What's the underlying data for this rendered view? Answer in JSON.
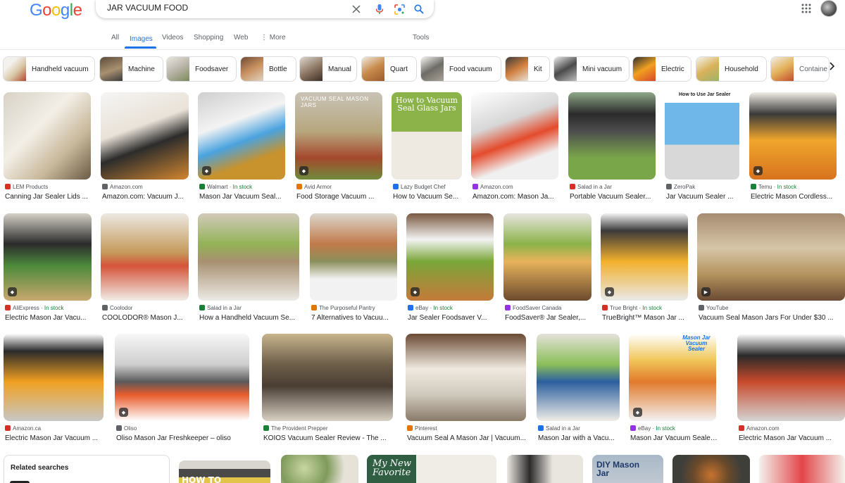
{
  "header": {
    "logo": "Google",
    "logo_colors": [
      "#4285f4",
      "#ea4335",
      "#fbbc05",
      "#4285f4",
      "#34a853",
      "#ea4335"
    ],
    "query": "JAR VACUUM FOOD",
    "icons": [
      "close-icon",
      "mic-icon",
      "lens-icon",
      "search-icon",
      "apps-icon",
      "avatar"
    ]
  },
  "tabs": {
    "items": [
      "All",
      "Images",
      "Videos",
      "Shopping",
      "Web",
      "More"
    ],
    "active": "Images",
    "tools": "Tools"
  },
  "chips": [
    "Handheld vacuum",
    "Machine",
    "Foodsaver",
    "Bottle",
    "Manual",
    "Quart",
    "Food vacuum",
    "Kit",
    "Mini vacuum",
    "Electric",
    "Household",
    "Containe"
  ],
  "row1": [
    {
      "source": "LEM Products",
      "stock": "",
      "title": "Canning Jar Sealer Lids ...",
      "badge": false
    },
    {
      "source": "Amazon.com",
      "stock": "",
      "title": "Amazon.com: Vacuum J...",
      "badge": false
    },
    {
      "source": "Walmart",
      "stock": "In stock",
      "title": "Mason Jar Vacuum Seal...",
      "badge": true
    },
    {
      "source": "Avid Armor",
      "stock": "",
      "title": "Food Storage Vacuum ...",
      "badge": true
    },
    {
      "source": "Lazy Budget Chef",
      "stock": "",
      "title": "How to Vacuum Se...",
      "badge": false
    },
    {
      "source": "Amazon.com",
      "stock": "",
      "title": "Amazon.com: Mason Ja...",
      "badge": false
    },
    {
      "source": "Salad in a Jar",
      "stock": "",
      "title": "Portable Vacuum Sealer...",
      "badge": false
    },
    {
      "source": "ZeroPak",
      "stock": "",
      "title": "Jar Vacuum Sealer ...",
      "badge": false
    },
    {
      "source": "Temu",
      "stock": "In stock",
      "title": "Electric Mason Cordless...",
      "badge": true
    }
  ],
  "row2": [
    {
      "source": "AliExpress",
      "stock": "In stock",
      "title": "Electric Mason Jar Vacu...",
      "badge": true
    },
    {
      "source": "Coolodor",
      "stock": "",
      "title": "COOLODOR® Mason J...",
      "badge": false
    },
    {
      "source": "Salad in a Jar",
      "stock": "",
      "title": "How a Handheld Vacuum Se...",
      "badge": false
    },
    {
      "source": "The Purposeful Pantry",
      "stock": "",
      "title": "7 Alternatives to Vacuu...",
      "badge": false
    },
    {
      "source": "eBay",
      "stock": "In stock",
      "title": "Jar Sealer Foodsaver V...",
      "badge": true
    },
    {
      "source": "FoodSaver Canada",
      "stock": "",
      "title": "FoodSaver® Jar Sealer,...",
      "badge": false
    },
    {
      "source": "True Bright",
      "stock": "In stock",
      "title": "TrueBright™ Mason Jar ...",
      "badge": true
    },
    {
      "source": "YouTube",
      "stock": "",
      "title": "Vacuum Seal Mason Jars For Under $30 ...",
      "badge": true
    }
  ],
  "row3": [
    {
      "source": "Amazon.ca",
      "stock": "",
      "title": "Electric Mason Jar Vacuum ...",
      "badge": false
    },
    {
      "source": "Oliso",
      "stock": "",
      "title": "Oliso Mason Jar Freshkeeper – oliso",
      "badge": true
    },
    {
      "source": "The Provident Prepper",
      "stock": "",
      "title": "KOIOS Vacuum Sealer Review - The ...",
      "badge": false
    },
    {
      "source": "Pinterest",
      "stock": "",
      "title": "Vacuum Seal A Mason Jar | Vacuum...",
      "badge": false
    },
    {
      "source": "Salad in a Jar",
      "stock": "",
      "title": "Mason Jar with a Vacu...",
      "badge": false
    },
    {
      "source": "eBay",
      "stock": "In stock",
      "title": "Mason Jar Vacuum Sealer K...",
      "badge": true
    },
    {
      "source": "Amazon.com",
      "stock": "",
      "title": "Electric Mason Jar Vacuum ...",
      "badge": false
    }
  ],
  "image_text": {
    "vacuum_seal_mason_jars": "VACUUM SEAL MASON JARS",
    "how_to_vacuum_seal": "How to Vacuum Seal Glass Jars",
    "how_to_use_jar_sealer": "How to Use Jar Sealer",
    "mason_jar_sealer": "Mason Jar Vacuum Sealer",
    "how_to": "HOW TO",
    "my_new_favorite": "My New Favorite",
    "diy_mason_jar": "DIY Mason Jar"
  },
  "related": {
    "title": "Related searches"
  }
}
